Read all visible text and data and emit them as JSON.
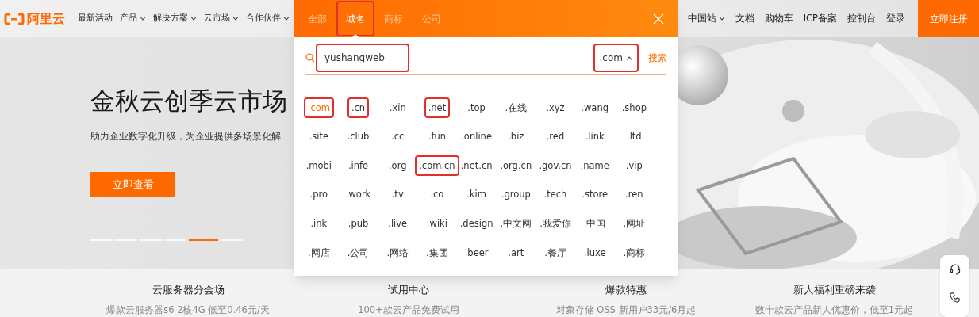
{
  "nav": {
    "logo": "阿里云",
    "items": [
      {
        "label": "最新活动",
        "dropdown": false
      },
      {
        "label": "产品",
        "dropdown": true
      },
      {
        "label": "解决方案",
        "dropdown": true
      },
      {
        "label": "云市场",
        "dropdown": true
      },
      {
        "label": "合作伙伴",
        "dropdown": true
      }
    ],
    "right_items": [
      {
        "label": "中国站",
        "dropdown": true
      },
      {
        "label": "文档",
        "dropdown": false
      },
      {
        "label": "购物车",
        "dropdown": false
      },
      {
        "label": "ICP备案",
        "dropdown": false
      },
      {
        "label": "控制台",
        "dropdown": false
      },
      {
        "label": "登录",
        "dropdown": false
      }
    ],
    "register_button": "立即注册"
  },
  "hero": {
    "title": "金秋云创季云市场",
    "subtitle": "助力企业数字化升级，为企业提供多场景化解",
    "button": "立即查看",
    "slides": [
      {
        "selected": false
      },
      {
        "selected": false
      },
      {
        "selected": false
      },
      {
        "selected": false
      },
      {
        "selected": true
      },
      {
        "selected": false
      }
    ]
  },
  "features": [
    {
      "title": "云服务器分会场",
      "subtitle": "爆款云服务器s6 2核4G 低至0.46元/天"
    },
    {
      "title": "试用中心",
      "subtitle": "100+款云产品免费试用"
    },
    {
      "title": "爆款特惠",
      "subtitle": "对象存储 OSS 新用户33元/6月起"
    },
    {
      "title": "新人福利重磅来袭",
      "subtitle": "数十款云产品新人优惠价，低至1元起"
    }
  ],
  "domain_panel": {
    "tabs": [
      {
        "label": "全部",
        "selected": false,
        "annotated": false
      },
      {
        "label": "域名",
        "selected": true,
        "annotated": true
      },
      {
        "label": "商标",
        "selected": false,
        "annotated": false
      },
      {
        "label": "公司",
        "selected": false,
        "annotated": false
      }
    ],
    "search": {
      "value": "yushangweb",
      "annotated": true
    },
    "suffix_select": {
      "value": ".com",
      "expanded": true,
      "annotated": true
    },
    "search_button": "搜索",
    "suffixes": [
      {
        "label": ".com",
        "selected": true,
        "annotated": true
      },
      {
        "label": ".cn",
        "selected": false,
        "annotated": true
      },
      {
        "label": ".xin",
        "selected": false,
        "annotated": false
      },
      {
        "label": ".net",
        "selected": false,
        "annotated": true
      },
      {
        "label": ".top",
        "selected": false,
        "annotated": false
      },
      {
        "label": ".在线",
        "selected": false,
        "annotated": false
      },
      {
        "label": ".xyz",
        "selected": false,
        "annotated": false
      },
      {
        "label": ".wang",
        "selected": false,
        "annotated": false
      },
      {
        "label": ".shop",
        "selected": false,
        "annotated": false
      },
      {
        "label": ".site",
        "selected": false,
        "annotated": false
      },
      {
        "label": ".club",
        "selected": false,
        "annotated": false
      },
      {
        "label": ".cc",
        "selected": false,
        "annotated": false
      },
      {
        "label": ".fun",
        "selected": false,
        "annotated": false
      },
      {
        "label": ".online",
        "selected": false,
        "annotated": false
      },
      {
        "label": ".biz",
        "selected": false,
        "annotated": false
      },
      {
        "label": ".red",
        "selected": false,
        "annotated": false
      },
      {
        "label": ".link",
        "selected": false,
        "annotated": false
      },
      {
        "label": ".ltd",
        "selected": false,
        "annotated": false
      },
      {
        "label": ".mobi",
        "selected": false,
        "annotated": false
      },
      {
        "label": ".info",
        "selected": false,
        "annotated": false
      },
      {
        "label": ".org",
        "selected": false,
        "annotated": false
      },
      {
        "label": ".com.cn",
        "selected": false,
        "annotated": true
      },
      {
        "label": ".net.cn",
        "selected": false,
        "annotated": false
      },
      {
        "label": ".org.cn",
        "selected": false,
        "annotated": false
      },
      {
        "label": ".gov.cn",
        "selected": false,
        "annotated": false
      },
      {
        "label": ".name",
        "selected": false,
        "annotated": false
      },
      {
        "label": ".vip",
        "selected": false,
        "annotated": false
      },
      {
        "label": ".pro",
        "selected": false,
        "annotated": false
      },
      {
        "label": ".work",
        "selected": false,
        "annotated": false
      },
      {
        "label": ".tv",
        "selected": false,
        "annotated": false
      },
      {
        "label": ".co",
        "selected": false,
        "annotated": false
      },
      {
        "label": ".kim",
        "selected": false,
        "annotated": false
      },
      {
        "label": ".group",
        "selected": false,
        "annotated": false
      },
      {
        "label": ".tech",
        "selected": false,
        "annotated": false
      },
      {
        "label": ".store",
        "selected": false,
        "annotated": false
      },
      {
        "label": ".ren",
        "selected": false,
        "annotated": false
      },
      {
        "label": ".ink",
        "selected": false,
        "annotated": false
      },
      {
        "label": ".pub",
        "selected": false,
        "annotated": false
      },
      {
        "label": ".live",
        "selected": false,
        "annotated": false
      },
      {
        "label": ".wiki",
        "selected": false,
        "annotated": false
      },
      {
        "label": ".design",
        "selected": false,
        "annotated": false
      },
      {
        "label": ".中文网",
        "selected": false,
        "annotated": false
      },
      {
        "label": ".我爱你",
        "selected": false,
        "annotated": false
      },
      {
        "label": ".中国",
        "selected": false,
        "annotated": false
      },
      {
        "label": ".网址",
        "selected": false,
        "annotated": false
      },
      {
        "label": ".网店",
        "selected": false,
        "annotated": false
      },
      {
        "label": ".公司",
        "selected": false,
        "annotated": false
      },
      {
        "label": ".网络",
        "selected": false,
        "annotated": false
      },
      {
        "label": ".集团",
        "selected": false,
        "annotated": false
      },
      {
        "label": ".beer",
        "selected": false,
        "annotated": false
      },
      {
        "label": ".art",
        "selected": false,
        "annotated": false
      },
      {
        "label": ".餐厅",
        "selected": false,
        "annotated": false
      },
      {
        "label": ".luxe",
        "selected": false,
        "annotated": false
      },
      {
        "label": ".商标",
        "selected": false,
        "annotated": false
      }
    ]
  }
}
